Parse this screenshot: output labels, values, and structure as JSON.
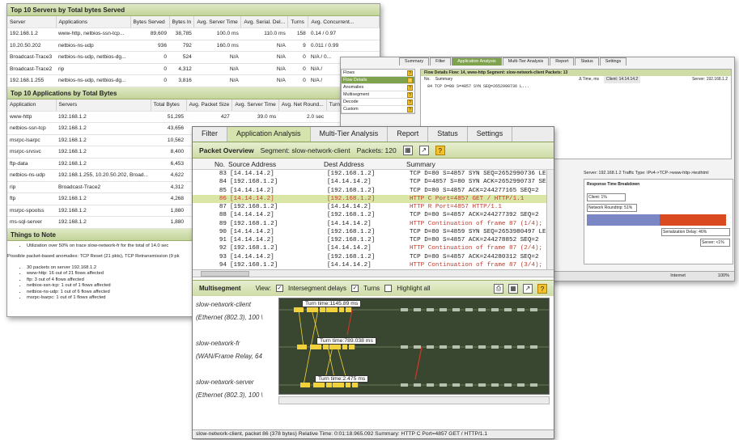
{
  "w1": {
    "servers_title": "Top 10 Servers by Total bytes Served",
    "servers_cols": [
      "Server",
      "Applications",
      "Bytes Served",
      "Bytes In",
      "Avg. Server Time",
      "Avg. Serial. Del...",
      "Turns",
      "Avg. Concurrent..."
    ],
    "servers_rows": [
      [
        "192.168.1.2",
        "www-http, netbios-ssn-tcp...",
        "89,609",
        "38,785",
        "100.0 ms",
        "110.0 ms",
        "158",
        "0.14 / 0.97"
      ],
      [
        "10.20.50.202",
        "netbios-ns-udp",
        "936",
        "792",
        "160.0 ms",
        "N/A",
        "9",
        "0.011 / 0.99"
      ],
      [
        "Broadcast-Trace3",
        "netbios-ns-udp, netbios-dg...",
        "0",
        "524",
        "N/A",
        "N/A",
        "0",
        "N/A / 0..."
      ],
      [
        "Broadcast-Trace2",
        "rip",
        "0",
        "4,312",
        "N/A",
        "N/A",
        "0",
        "N/A /"
      ],
      [
        "192.168.1.255",
        "netbios-ns-udp, netbios-dg...",
        "0",
        "3,816",
        "N/A",
        "N/A",
        "0",
        "N/A /"
      ]
    ],
    "apps_title": "Top 10 Applications by Total Bytes",
    "apps_cols": [
      "Application",
      "Servers",
      "Total Bytes",
      "Avg. Packet Size",
      "Avg. Server Time",
      "Avg. Net Round...",
      "Turns"
    ],
    "apps_rows": [
      [
        "www-http",
        "192.168.1.2",
        "51,295",
        "427",
        "39.0 ms",
        "2.0 sec",
        "18"
      ],
      [
        "netbios-ssn-tcp",
        "192.168.1.2",
        "43,656",
        "",
        "",
        "",
        ""
      ],
      [
        "msrpc-lsarpc",
        "192.168.1.2",
        "10,562",
        "",
        "",
        "",
        ""
      ],
      [
        "msrpc-srvsvc",
        "192.168.1.2",
        "8,400",
        "",
        "",
        "",
        ""
      ],
      [
        "ftp-data",
        "192.168.1.2",
        "6,453",
        "",
        "",
        "",
        ""
      ],
      [
        "netbios-ns-udp",
        "192.168.1.255, 10.20.50.202, Broad...",
        "4,622",
        "",
        "",
        "",
        ""
      ],
      [
        "rip",
        "Broadcast-Trace2",
        "4,312",
        "",
        "",
        "",
        ""
      ],
      [
        "ftp",
        "192.168.1.2",
        "4,268",
        "",
        "",
        "",
        ""
      ],
      [
        "msrpc-spoolss",
        "192.168.1.2",
        "1,880",
        "",
        "",
        "",
        ""
      ],
      [
        "ms-sql-server",
        "192.168.1.2",
        "1,880",
        "",
        "",
        "",
        ""
      ]
    ],
    "notes_title": "Things to Note",
    "note1": "Utilization over 50% on trace slow-network-fr for the total of 14.0 sec",
    "anomalies": "Possible packet-based anomalies: TCP Reset (21 pkts), TCP Retransmission (9 pk",
    "bullets": [
      "30 packets on server 192.168.1.2",
      "www-http: 16 out of 21 flows affected",
      "ftp: 3 out of 4 flows affected",
      "netbios-ssn-tcp: 1 out of 1 flows affected",
      "netbios-ns-udp: 1 out of 6 flows affected",
      "msrpc-lsarpc: 1 out of 1 flows affected"
    ]
  },
  "w2": {
    "tabs": [
      "Summary",
      "Filter",
      "Application Analysis",
      "Multi-Tier Analysis",
      "Report",
      "Status",
      "Settings"
    ],
    "nav": [
      "Flows",
      "Flow Details",
      "Anomalies",
      "Multisegment",
      "Decode",
      "Custom"
    ],
    "flow_header": "Flow Details    Flow: 14, www-http    Segment: slow-network-client    Packets: 13",
    "col_no": "No.",
    "col_summary": "Summary",
    "col_time": "Δ Time, ms",
    "client": "Client: 14.14.14.2",
    "server": "Server: 192.168.1.2",
    "pkts": [
      "84  TCP D=80 S=4857 SYN SEQ=2652990736 L...",
      "85  TCP D=4857 S=80 SYN ACK=2652990737 SE...",
      "86  TCP D=80 S=4857     ACK=244277165 SE...",
      "86  HTTP C Port=4857  GET / HTTP/1.1",
      "87  HTTP R Port=4857  HTTP/1.1"
    ],
    "times": [
      "",
      "196.062",
      "0.598",
      "0.439",
      "1145.889"
    ],
    "legend": "ssions  ■ Data packet  □ ACK-only  ▬ Resp/Req start",
    "server_line": "Server: 192.168.1.2    Traffic Type: IPv4->TCP->www-http->testhtml",
    "rt_title": "Response Time Breakdown",
    "rt_client": "Client: 1%",
    "rt_net": "Network Roundtrip: 51%",
    "rt_serial": "Serialization Delay: 46%",
    "rt_server": "Server: <1%",
    "status_internet": "Internet",
    "status_zoom": "100%"
  },
  "w3": {
    "tabs": [
      "Filter",
      "Application Analysis",
      "Multi-Tier Analysis",
      "Report",
      "Status",
      "Settings"
    ],
    "po_title": "Packet Overview",
    "po_segment": "Segment: slow-network-client",
    "po_packets": "Packets: 120",
    "col_no": "No.",
    "col_src": "Source Address",
    "col_dst": "Dest Address",
    "col_sum": "Summary",
    "rows": [
      [
        "83",
        "[14.14.14.2]",
        "[192.168.1.2]",
        "TCP D=80 S=4857 SYN SEQ=2652990736 LEN="
      ],
      [
        "84",
        "[192.168.1.2]",
        "[14.14.14.2]",
        "TCP D=4857 S=80 SYN ACK=2652990737 SEQ="
      ],
      [
        "85",
        "[14.14.14.2]",
        "[192.168.1.2]",
        "TCP D=80 S=4857     ACK=244277165 SEQ=2"
      ],
      [
        "86",
        "[14.14.14.2]",
        "[192.168.1.2]",
        "HTTP C Port=4857  GET / HTTP/1.1"
      ],
      [
        "87",
        "[192.168.1.2]",
        "[14.14.14.2]",
        "HTTP R Port=4857  HTTP/1.1"
      ],
      [
        "88",
        "[14.14.14.2]",
        "[192.168.1.2]",
        "TCP D=80 S=4857     ACK=244277392 SEQ=2"
      ],
      [
        "89",
        "[192.168.1.2]",
        "[14.14.14.2]",
        "HTTP Continuation of frame 87 (1/4); 14"
      ],
      [
        "90",
        "[14.14.14.2]",
        "[192.168.1.2]",
        "TCP D=80 S=4859 SYN SEQ=2653980497 LEN="
      ],
      [
        "91",
        "[14.14.14.2]",
        "[192.168.1.2]",
        "TCP D=80 S=4857     ACK=244278852 SEQ=2"
      ],
      [
        "92",
        "[192.168.1.2]",
        "[14.14.14.2]",
        "HTTP Continuation of frame 87 (2/4); 14"
      ],
      [
        "93",
        "[14.14.14.2]",
        "[192.168.1.2]",
        "TCP D=80 S=4857     ACK=244280312 SEQ=2"
      ],
      [
        "94",
        "[192.168.1.2]",
        "[14.14.14.2]",
        "HTTP Continuation of frame 87 (3/4); 14"
      ]
    ],
    "ms_title": "Multisegment",
    "ms_view": "View:",
    "ms_opt1": "Intersegment delays",
    "ms_opt2": "Turns",
    "ms_opt3": "Highlight all",
    "seg1": "slow-network-client",
    "seg1b": "(Ethernet (802.3), 100 \\",
    "seg2": "slow-network-fr",
    "seg2b": "(WAN/Frame Relay, 64",
    "seg3": "slow-network-server",
    "seg3b": "(Ethernet (802.3), 100 \\",
    "turn1": "Turn time:1145.89 ms",
    "turn2": "Turn time:789.038 ms",
    "turn3": "Turn time:2.475 ms",
    "status": "slow-network-client, packet 86 (378 bytes) Relative Time: 0:01:18.965.092 Summary: HTTP C Port=4857  GET / HTTP/1.1"
  },
  "colors": {
    "accent_green": "#7fa34d",
    "header_green": "#c3d49a",
    "selected_row": "#d9e6a6",
    "http_red": "#c0392b",
    "chart_bg": "#3a4730",
    "packet_yellow": "#f2d23a"
  }
}
